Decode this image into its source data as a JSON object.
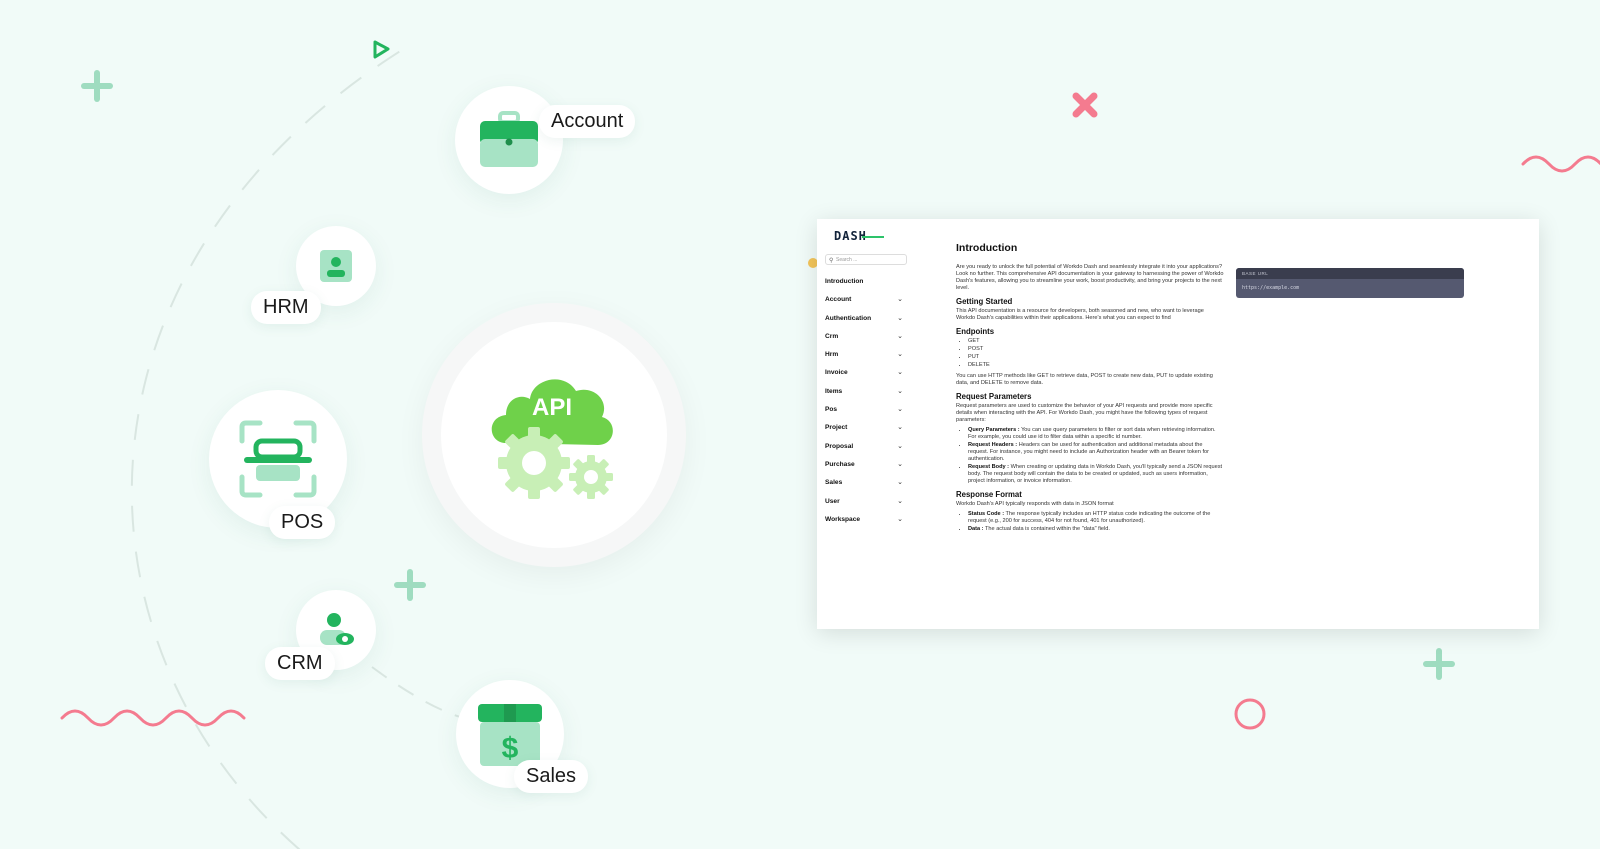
{
  "modules": {
    "account": "Account",
    "hrm": "HRM",
    "pos": "POS",
    "crm": "CRM",
    "sales": "Sales",
    "api": "API"
  },
  "doc": {
    "logo": "DASH",
    "search_placeholder": "Search ...",
    "nav": [
      {
        "label": "Introduction",
        "chevron": false
      },
      {
        "label": "Account",
        "chevron": true
      },
      {
        "label": "Authentication",
        "chevron": true
      },
      {
        "label": "Crm",
        "chevron": true
      },
      {
        "label": "Hrm",
        "chevron": true
      },
      {
        "label": "Invoice",
        "chevron": true
      },
      {
        "label": "Items",
        "chevron": true
      },
      {
        "label": "Pos",
        "chevron": true
      },
      {
        "label": "Project",
        "chevron": true
      },
      {
        "label": "Proposal",
        "chevron": true
      },
      {
        "label": "Purchase",
        "chevron": true
      },
      {
        "label": "Sales",
        "chevron": true
      },
      {
        "label": "User",
        "chevron": true
      },
      {
        "label": "Workspace",
        "chevron": true
      }
    ],
    "title": "Introduction",
    "intro": "Are you ready to unlock the full potential of Workdo Dash and seamlessly integrate it into your applications? Look no further. This comprehensive API documentation is your gateway to harnessing the power of Workdo Dash's features, allowing you to streamline your work, boost productivity, and bring your projects to the next level.",
    "getting_started_heading": "Getting Started",
    "getting_started_text": "This API documentation is a resource for developers, both seasoned and new, who want to leverage Workdo Dash's capabilities within their applications. Here's what you can expect to find",
    "endpoints_heading": "Endpoints",
    "endpoints": [
      "GET",
      "POST",
      "PUT",
      "DELETE"
    ],
    "endpoints_text": "You can use HTTP methods like GET to retrieve data, POST to create new data, PUT to update existing data, and DELETE to remove data.",
    "request_heading": "Request Parameters",
    "request_text": "Request parameters are used to customize the behavior of your API requests and provide more specific details when interacting with the API. For Workdo Dash, you might have the following types of request parameters:",
    "request_params": [
      {
        "name": "Query Parameters :",
        "text": "You can use query parameters to filter or sort data when retrieving information. For example, you could use id to filter data within a specific id number."
      },
      {
        "name": "Request Headers :",
        "text": "Headers can be used for authentication and additional metadata about the request. For instance, you might need to include an Authorization header with an Bearer token for authentication."
      },
      {
        "name": "Request Body :",
        "text": "When creating or updating data in Workdo Dash, you'll typically send a JSON request body. The request body will contain the data to be created or updated, such as users information, project information, or invoice information."
      }
    ],
    "response_heading": "Response Format",
    "response_text": "Workdo Dash's API typically responds with data in JSON format",
    "response_items": [
      {
        "name": "Status Code :",
        "text": "The response typically includes an HTTP status code indicating the outcome of the request (e.g., 200 for success, 404 for not found, 401 for unauthorized)."
      },
      {
        "name": "Data :",
        "text": "The actual data is contained within the \"data\" field."
      }
    ],
    "base_url_label": "BASE URL",
    "base_url": "https://example.com"
  },
  "colors": {
    "brand_green": "#2dc36a",
    "light_green": "#a7e3c5",
    "deco_pink": "#f47b8f",
    "api_green": "#6fd14a"
  }
}
